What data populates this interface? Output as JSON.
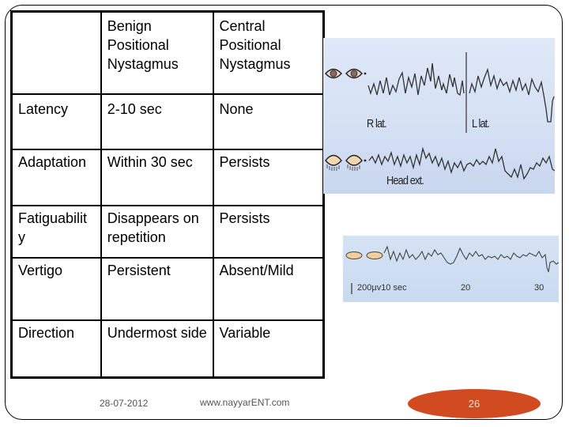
{
  "table": {
    "header": [
      "",
      "Benign Positional Nystagmus",
      "Central Positional Nystagmus"
    ],
    "rows": [
      [
        "Latency",
        "2-10 sec",
        "None"
      ],
      [
        "Adaptation",
        "Within 30 sec",
        "Persists"
      ],
      [
        "Fatiguability",
        "Disappears on repetition",
        "Persists"
      ],
      [
        "Vertigo",
        "Persistent",
        "Absent/Mild"
      ],
      [
        "Direction",
        "Undermost side",
        "Variable"
      ]
    ],
    "header_display": [
      "",
      "Benign\nPositional\nNystagmus",
      "Central\nPositional\nNystagmus"
    ]
  },
  "figure1": {
    "labels": {
      "r_lat": "R lat.",
      "l_lat": "L lat.",
      "head_ext": "Head ext."
    }
  },
  "figure2": {
    "labels": {
      "scale": "200µv10 sec",
      "tick_20": "20",
      "tick_30": "30"
    }
  },
  "footer": {
    "date": "28-07-2012",
    "url": "www.nayyarENT.com",
    "page_number": "26"
  },
  "colors": {
    "page_badge": "#d24a1f",
    "figure_background": "#d4e0f4"
  }
}
